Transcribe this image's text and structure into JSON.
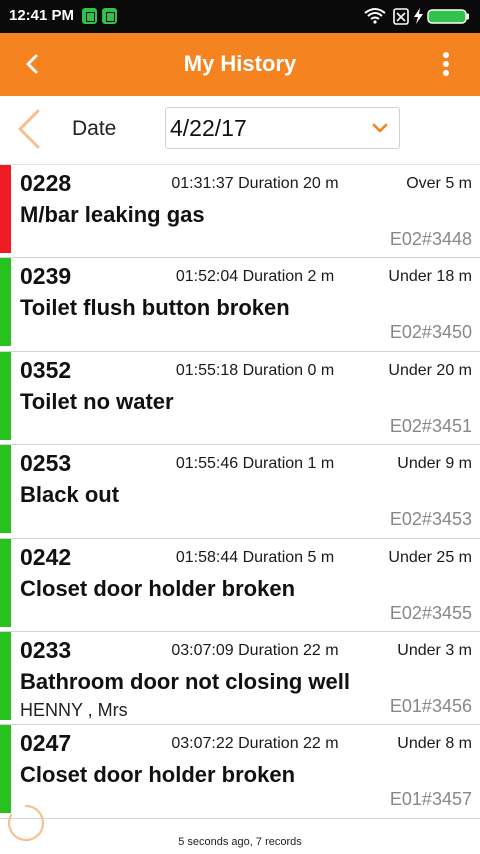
{
  "status_bar": {
    "time": "12:41 PM",
    "notification_icons": [
      "notes-app-icon",
      "messenger-app-icon"
    ],
    "system_icons": [
      "wifi-icon",
      "no-sim-icon",
      "charging-icon",
      "battery-full-icon"
    ]
  },
  "app_bar": {
    "title": "My History",
    "back_icon": "chevron-left-icon",
    "menu_icon": "more-vertical-icon",
    "color": "#f5831f"
  },
  "date_bar": {
    "label": "Date",
    "value": "4/22/17",
    "dropdown_icon": "chevron-down-icon",
    "prev_icon": "chevron-left-icon"
  },
  "records": [
    {
      "room": "0228",
      "time": "01:31:37",
      "duration": "Duration 20 m",
      "limit": "Over 5 m",
      "issue": "M/bar leaking gas",
      "person": "",
      "code": "E02#3448",
      "status_color": "#ee1c24"
    },
    {
      "room": "0239",
      "time": "01:52:04",
      "duration": "Duration 2 m",
      "limit": "Under 18 m",
      "issue": "Toilet flush button broken",
      "person": "",
      "code": "E02#3450",
      "status_color": "#27c21f"
    },
    {
      "room": "0352",
      "time": "01:55:18",
      "duration": "Duration 0 m",
      "limit": "Under 20 m",
      "issue": "Toilet no water",
      "person": "",
      "code": "E02#3451",
      "status_color": "#27c21f"
    },
    {
      "room": "0253",
      "time": "01:55:46",
      "duration": "Duration 1 m",
      "limit": "Under 9 m",
      "issue": "Black out",
      "person": "",
      "code": "E02#3453",
      "status_color": "#27c21f"
    },
    {
      "room": "0242",
      "time": "01:58:44",
      "duration": "Duration 5 m",
      "limit": "Under 25 m",
      "issue": "Closet door holder broken",
      "person": "",
      "code": "E02#3455",
      "status_color": "#27c21f"
    },
    {
      "room": "0233",
      "time": "03:07:09",
      "duration": "Duration 22 m",
      "limit": "Under 3 m",
      "issue": "Bathroom door not closing well",
      "person": "HENNY , Mrs",
      "code": "E01#3456",
      "status_color": "#27c21f"
    },
    {
      "room": "0247",
      "time": "03:07:22",
      "duration": "Duration 22 m",
      "limit": "Under 8 m",
      "issue": "Closet door holder broken",
      "person": "",
      "code": "E01#3457",
      "status_color": "#27c21f"
    }
  ],
  "footer": {
    "summary": "5 seconds ago, 7 records",
    "spinner_icon": "loading-spinner-icon"
  }
}
